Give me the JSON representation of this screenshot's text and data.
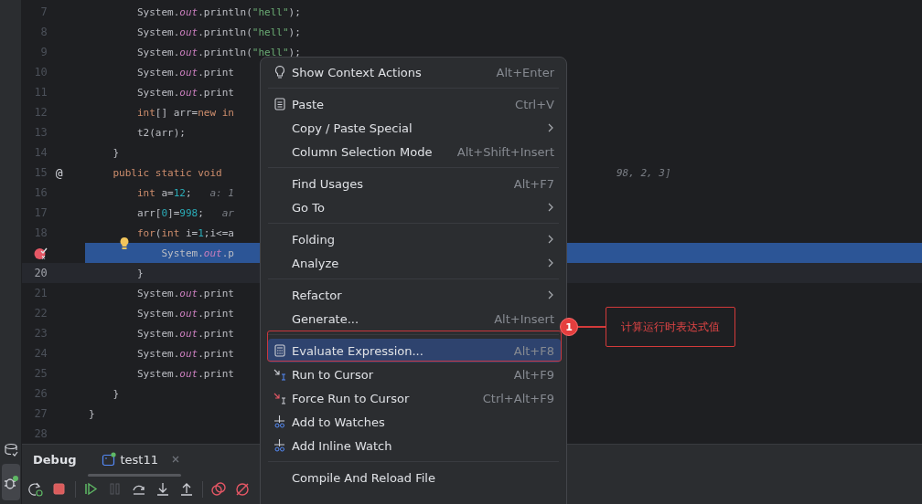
{
  "tool_strip": {
    "items": [
      {
        "kind": "database",
        "selected": false
      },
      {
        "kind": "debug",
        "selected": true
      }
    ]
  },
  "editor": {
    "lines": [
      {
        "number": "7",
        "tokens": [
          {
            "text": "        System.",
            "kind": "plain"
          },
          {
            "text": "out",
            "kind": "field"
          },
          {
            "text": ".println(",
            "kind": "plain"
          },
          {
            "text": "\"hell\"",
            "kind": "string"
          },
          {
            "text": ");",
            "kind": "plain"
          }
        ]
      },
      {
        "number": "8",
        "tokens": [
          {
            "text": "        System.",
            "kind": "plain"
          },
          {
            "text": "out",
            "kind": "field"
          },
          {
            "text": ".println(",
            "kind": "plain"
          },
          {
            "text": "\"hell\"",
            "kind": "string"
          },
          {
            "text": ");",
            "kind": "plain"
          }
        ]
      },
      {
        "number": "9",
        "tokens": [
          {
            "text": "        System.",
            "kind": "plain"
          },
          {
            "text": "out",
            "kind": "field"
          },
          {
            "text": ".println(",
            "kind": "plain"
          },
          {
            "text": "\"hell\"",
            "kind": "string"
          },
          {
            "text": ");",
            "kind": "plain"
          }
        ]
      },
      {
        "number": "10",
        "tokens": [
          {
            "text": "        System.",
            "kind": "plain"
          },
          {
            "text": "out",
            "kind": "field"
          },
          {
            "text": ".print",
            "kind": "plain"
          }
        ]
      },
      {
        "number": "11",
        "tokens": [
          {
            "text": "        System.",
            "kind": "plain"
          },
          {
            "text": "out",
            "kind": "field"
          },
          {
            "text": ".print",
            "kind": "plain"
          }
        ]
      },
      {
        "number": "12",
        "tokens": [
          {
            "text": "        int",
            "kind": "keyword"
          },
          {
            "text": "[] arr=",
            "kind": "plain"
          },
          {
            "text": "new in",
            "kind": "keyword"
          }
        ]
      },
      {
        "number": "13",
        "tokens": [
          {
            "text": "        t2(arr);",
            "kind": "plain"
          }
        ]
      },
      {
        "number": "14",
        "tokens": [
          {
            "text": "    }",
            "kind": "plain"
          }
        ]
      },
      {
        "number": "15",
        "gutter_mark": "@",
        "tokens": [
          {
            "text": "    public static void",
            "kind": "keyword"
          }
        ],
        "tail": "98, 2, 3]"
      },
      {
        "number": "16",
        "tokens": [
          {
            "text": "        int",
            "kind": "keyword"
          },
          {
            "text": " a=",
            "kind": "plain"
          },
          {
            "text": "12",
            "kind": "number"
          },
          {
            "text": ";",
            "kind": "plain"
          },
          {
            "text": "   a: 1",
            "kind": "hint"
          }
        ]
      },
      {
        "number": "17",
        "tokens": [
          {
            "text": "        arr[",
            "kind": "plain"
          },
          {
            "text": "0",
            "kind": "number"
          },
          {
            "text": "]=",
            "kind": "plain"
          },
          {
            "text": "998",
            "kind": "number"
          },
          {
            "text": ";",
            "kind": "plain"
          },
          {
            "text": "   ar",
            "kind": "hint"
          }
        ]
      },
      {
        "number": "18",
        "tokens": [
          {
            "text": "        for",
            "kind": "keyword"
          },
          {
            "text": "(",
            "kind": "plain"
          },
          {
            "text": "int",
            "kind": "keyword"
          },
          {
            "text": " i=",
            "kind": "plain"
          },
          {
            "text": "1",
            "kind": "number"
          },
          {
            "text": ";i<=a",
            "kind": "plain"
          }
        ]
      },
      {
        "breakpoint": true,
        "execution_point": true,
        "intention_bulb": true,
        "tokens": [
          {
            "text": "            System.",
            "kind": "plain"
          },
          {
            "text": "out",
            "kind": "field"
          },
          {
            "text": ".p",
            "kind": "plain"
          }
        ]
      },
      {
        "number": "20",
        "current": true,
        "tokens": [
          {
            "text": "        }",
            "kind": "plain"
          }
        ]
      },
      {
        "number": "21",
        "tokens": [
          {
            "text": "        System.",
            "kind": "plain"
          },
          {
            "text": "out",
            "kind": "field"
          },
          {
            "text": ".print",
            "kind": "plain"
          }
        ]
      },
      {
        "number": "22",
        "tokens": [
          {
            "text": "        System.",
            "kind": "plain"
          },
          {
            "text": "out",
            "kind": "field"
          },
          {
            "text": ".print",
            "kind": "plain"
          }
        ]
      },
      {
        "number": "23",
        "tokens": [
          {
            "text": "        System.",
            "kind": "plain"
          },
          {
            "text": "out",
            "kind": "field"
          },
          {
            "text": ".print",
            "kind": "plain"
          }
        ]
      },
      {
        "number": "24",
        "tokens": [
          {
            "text": "        System.",
            "kind": "plain"
          },
          {
            "text": "out",
            "kind": "field"
          },
          {
            "text": ".print",
            "kind": "plain"
          }
        ]
      },
      {
        "number": "25",
        "tokens": [
          {
            "text": "        System.",
            "kind": "plain"
          },
          {
            "text": "out",
            "kind": "field"
          },
          {
            "text": ".print",
            "kind": "plain"
          }
        ]
      },
      {
        "number": "26",
        "tokens": [
          {
            "text": "    }",
            "kind": "plain"
          }
        ]
      },
      {
        "number": "27",
        "tokens": [
          {
            "text": "}",
            "kind": "plain"
          }
        ]
      },
      {
        "number": "28"
      }
    ]
  },
  "context_menu": {
    "groups": [
      {
        "items": [
          {
            "label": "Show Context Actions",
            "shortcut": "Alt+Enter",
            "kind": "bulb",
            "selected": false
          }
        ]
      },
      {
        "items": [
          {
            "label": "Paste",
            "shortcut": "Ctrl+V",
            "kind": "clipboard",
            "selected": false
          },
          {
            "label": "Copy / Paste Special",
            "submenu": true,
            "selected": false
          },
          {
            "label": "Column Selection Mode",
            "shortcut": "Alt+Shift+Insert",
            "selected": false
          }
        ]
      },
      {
        "items": [
          {
            "label": "Find Usages",
            "shortcut": "Alt+F7",
            "selected": false
          },
          {
            "label": "Go To",
            "submenu": true,
            "selected": false
          }
        ]
      },
      {
        "items": [
          {
            "label": "Folding",
            "submenu": true,
            "selected": false
          },
          {
            "label": "Analyze",
            "submenu": true,
            "selected": false
          }
        ]
      },
      {
        "items": [
          {
            "label": "Refactor",
            "submenu": true,
            "selected": false
          },
          {
            "label": "Generate...",
            "shortcut": "Alt+Insert",
            "selected": false
          }
        ]
      },
      {
        "items": [
          {
            "label": "Evaluate Expression...",
            "shortcut": "Alt+F8",
            "kind": "calculator",
            "selected": true,
            "annotated": true
          },
          {
            "label": "Run to Cursor",
            "shortcut": "Alt+F9",
            "kind": "run-cursor",
            "selected": false
          },
          {
            "label": "Force Run to Cursor",
            "shortcut": "Ctrl+Alt+F9",
            "kind": "force-run-cursor",
            "selected": false
          },
          {
            "label": "Add to Watches",
            "kind": "watch",
            "selected": false
          },
          {
            "label": "Add Inline Watch",
            "kind": "watch",
            "selected": false
          }
        ]
      },
      {
        "items": [
          {
            "label": "Compile And Reload File",
            "selected": false
          }
        ]
      }
    ]
  },
  "annotation": {
    "number": "1",
    "text": "计算运行时表达式值"
  },
  "debug_panel": {
    "title": "Debug",
    "tabs": [
      {
        "label": "test11",
        "selected": true
      }
    ],
    "toolbar": [
      {
        "kind": "rerun",
        "disabled": false
      },
      {
        "kind": "stop",
        "disabled": false
      },
      {
        "kind": "resume",
        "disabled": false
      },
      {
        "kind": "pause",
        "disabled": true
      },
      {
        "kind": "step-over",
        "disabled": false
      },
      {
        "kind": "step-into",
        "disabled": false
      },
      {
        "kind": "step-out",
        "disabled": false
      },
      {
        "kind": "breakpoints",
        "disabled": false
      },
      {
        "kind": "mute-breakpoints",
        "disabled": false
      }
    ]
  }
}
